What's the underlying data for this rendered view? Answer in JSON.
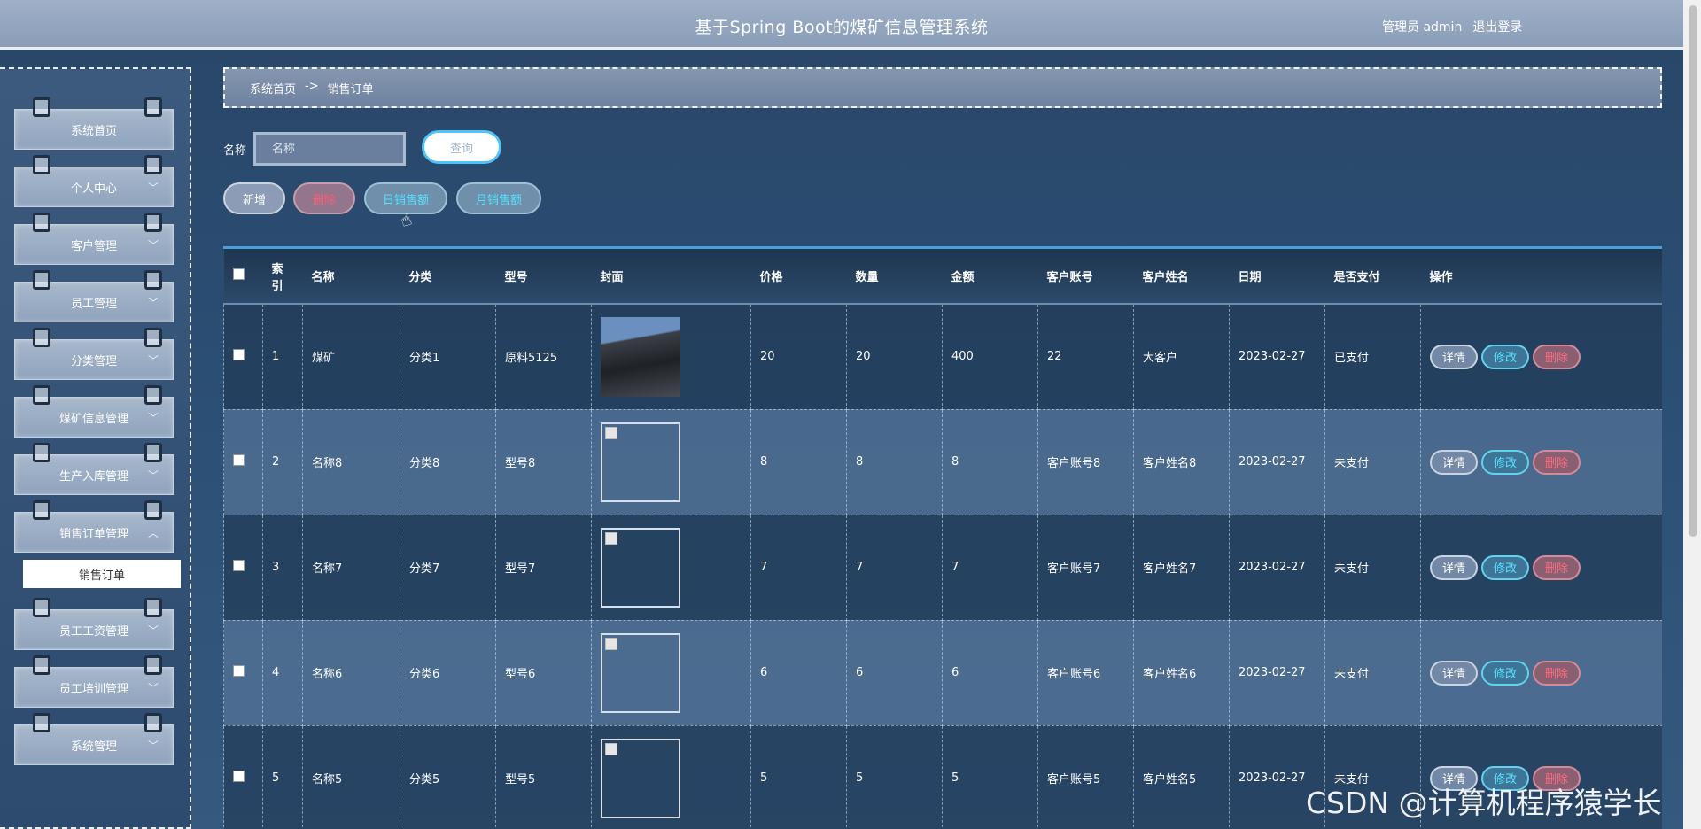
{
  "header": {
    "title": "基于Spring Boot的煤矿信息管理系统",
    "user_label": "管理员 admin",
    "logout_label": "退出登录"
  },
  "sidebar": {
    "items": [
      {
        "label": "系统首页",
        "expandable": false
      },
      {
        "label": "个人中心",
        "expandable": true
      },
      {
        "label": "客户管理",
        "expandable": true
      },
      {
        "label": "员工管理",
        "expandable": true
      },
      {
        "label": "分类管理",
        "expandable": true
      },
      {
        "label": "煤矿信息管理",
        "expandable": true
      },
      {
        "label": "生产入库管理",
        "expandable": true
      },
      {
        "label": "销售订单管理",
        "expandable": true,
        "expanded": true
      },
      {
        "label": "员工工资管理",
        "expandable": true
      },
      {
        "label": "员工培训管理",
        "expandable": true
      },
      {
        "label": "系统管理",
        "expandable": true
      }
    ],
    "active_submenu": "销售订单"
  },
  "breadcrumb": {
    "home": "系统首页",
    "separator": "->",
    "current": "销售订单"
  },
  "search": {
    "label": "名称",
    "placeholder": "名称",
    "button": "查询"
  },
  "actions": {
    "add": "新增",
    "delete": "删除",
    "daily_sales": "日销售额",
    "monthly_sales": "月销售额"
  },
  "table": {
    "headers": [
      "",
      "索引",
      "名称",
      "分类",
      "型号",
      "封面",
      "价格",
      "数量",
      "金额",
      "客户账号",
      "客户姓名",
      "日期",
      "是否支付",
      "操作"
    ],
    "rows": [
      {
        "index": "1",
        "name": "煤矿",
        "category": "分类1",
        "model": "原料5125",
        "cover": "photo",
        "price": "20",
        "qty": "20",
        "amount": "400",
        "account": "22",
        "customer": "大客户",
        "date": "2023-02-27",
        "paid": "已支付"
      },
      {
        "index": "2",
        "name": "名称8",
        "category": "分类8",
        "model": "型号8",
        "cover": "broken",
        "price": "8",
        "qty": "8",
        "amount": "8",
        "account": "客户账号8",
        "customer": "客户姓名8",
        "date": "2023-02-27",
        "paid": "未支付"
      },
      {
        "index": "3",
        "name": "名称7",
        "category": "分类7",
        "model": "型号7",
        "cover": "broken",
        "price": "7",
        "qty": "7",
        "amount": "7",
        "account": "客户账号7",
        "customer": "客户姓名7",
        "date": "2023-02-27",
        "paid": "未支付"
      },
      {
        "index": "4",
        "name": "名称6",
        "category": "分类6",
        "model": "型号6",
        "cover": "broken",
        "price": "6",
        "qty": "6",
        "amount": "6",
        "account": "客户账号6",
        "customer": "客户姓名6",
        "date": "2023-02-27",
        "paid": "未支付"
      },
      {
        "index": "5",
        "name": "名称5",
        "category": "分类5",
        "model": "型号5",
        "cover": "broken",
        "price": "5",
        "qty": "5",
        "amount": "5",
        "account": "客户账号5",
        "customer": "客户姓名5",
        "date": "2023-02-27",
        "paid": "未支付"
      }
    ],
    "row_actions": {
      "detail": "详情",
      "edit": "修改",
      "delete": "删除"
    }
  },
  "watermark": "CSDN @计算机程序猿学长"
}
